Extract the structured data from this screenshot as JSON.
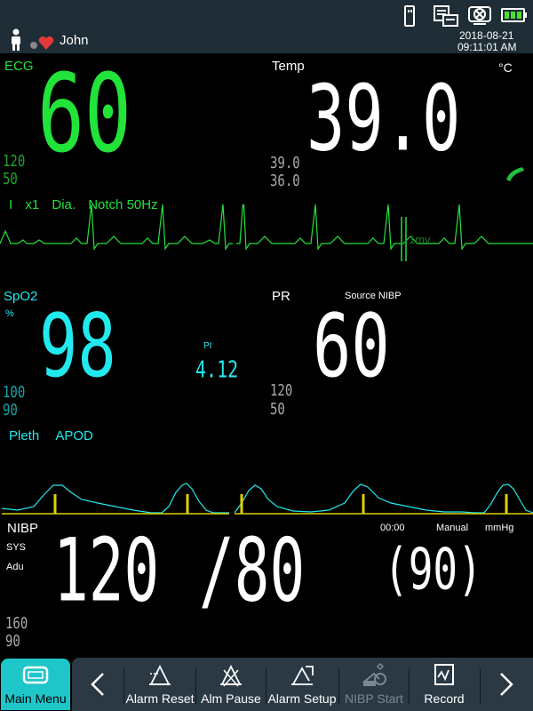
{
  "header": {
    "patient_name": "John",
    "date": "2018-08-21",
    "time": "09:11:01 AM",
    "icons": [
      "patient-icon",
      "heart-icon",
      "usb-icon",
      "network-icon",
      "device-icon",
      "battery-icon"
    ]
  },
  "ecg": {
    "label": "ECG",
    "value": "60",
    "limit_high": "120",
    "limit_low": "50",
    "info": [
      "I",
      "x1",
      "Dia.",
      "Notch 50Hz"
    ],
    "scale_label": "1mv",
    "color": "#22e33a"
  },
  "temp": {
    "label": "Temp",
    "unit": "°C",
    "value": "39.0",
    "limit_high": "39.0",
    "limit_low": "36.0"
  },
  "spo2": {
    "label": "SpO2",
    "unit": "%",
    "value": "98",
    "limit_high": "100",
    "limit_low": "90",
    "pi_label": "PI",
    "pi_value": "4.12",
    "info": [
      "Pleth",
      "APOD"
    ],
    "color": "#22e9ee"
  },
  "pr": {
    "label": "PR",
    "source": "Source NIBP",
    "value": "60",
    "limit_high": "120",
    "limit_low": "50"
  },
  "nibp": {
    "label": "NIBP",
    "sub1": "SYS",
    "sub2": "Adu",
    "value": "120",
    "dia": "/80",
    "map": "(90)",
    "time": "00:00",
    "mode": "Manual",
    "unit": "mmHg",
    "limit_high": "160",
    "limit_low": "90"
  },
  "toolbar": {
    "main_menu": "Main Menu",
    "alarm_reset": "Alarm Reset",
    "alm_pause": "Alm Pause",
    "alarm_setup": "Alarm Setup",
    "nibp_start": "NIBP Start",
    "record": "Record"
  }
}
